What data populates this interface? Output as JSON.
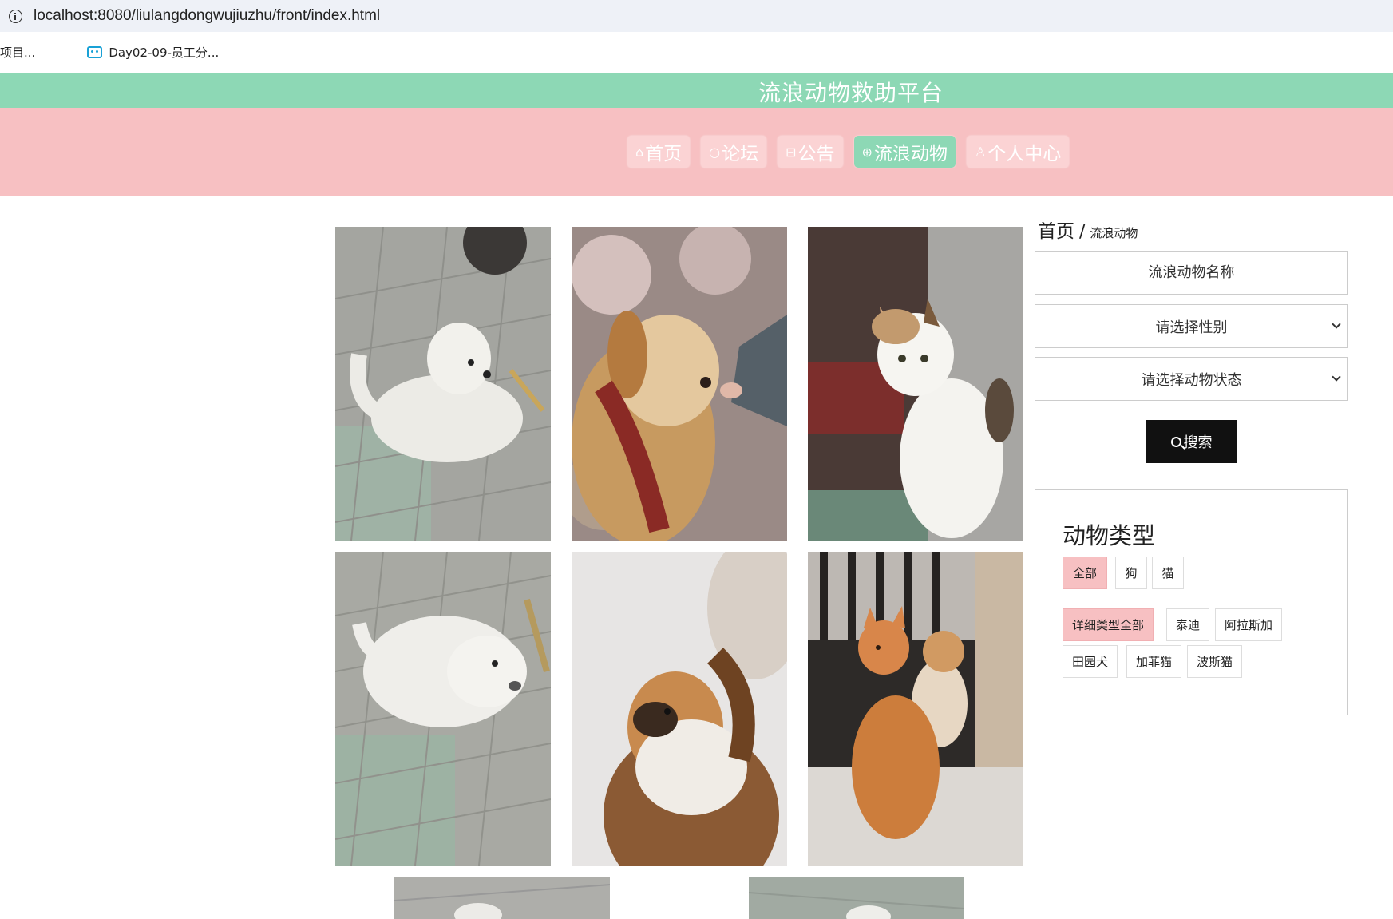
{
  "browser": {
    "url_host": "localhost",
    "url_rest": ":8080/liulangdongwujiuzhu/front/index.html",
    "bookmarks": [
      {
        "label": "项目..."
      },
      {
        "label": "Day02-09-员工分...",
        "icon": "tv-icon"
      }
    ]
  },
  "header": {
    "site_title": "流浪动物救助平台",
    "nav": [
      {
        "label": "首页",
        "icon": "⌂",
        "active": false
      },
      {
        "label": "论坛",
        "icon": "○",
        "active": false
      },
      {
        "label": "公告",
        "icon": "⊟",
        "active": false
      },
      {
        "label": "流浪动物",
        "icon": "⊕",
        "active": true
      },
      {
        "label": "个人中心",
        "icon": "♙",
        "active": false
      }
    ],
    "colors": {
      "title_bar": "#8dd8b5",
      "nav_bar": "#f7c0c2",
      "nav_active": "#8dd8b5"
    }
  },
  "breadcrumb": {
    "home": "首页",
    "separator": "/",
    "current": "流浪动物"
  },
  "search": {
    "name_placeholder": "流浪动物名称",
    "gender_select": "请选择性别",
    "status_select": "请选择动物状态",
    "button_label": "搜索"
  },
  "type_panel": {
    "title": "动物类型",
    "types": [
      {
        "label": "全部",
        "selected": true
      },
      {
        "label": "狗",
        "selected": false
      },
      {
        "label": "猫",
        "selected": false
      }
    ],
    "sub_types": [
      {
        "label": "详细类型全部",
        "selected": true
      },
      {
        "label": "泰迪",
        "selected": false
      },
      {
        "label": "阿拉斯加",
        "selected": false
      },
      {
        "label": "田园犬",
        "selected": false
      },
      {
        "label": "加菲猫",
        "selected": false
      },
      {
        "label": "波斯猫",
        "selected": false
      }
    ]
  },
  "gallery": [
    {
      "subject": "white-puppy-lying"
    },
    {
      "subject": "golden-dog-sniffing-hand"
    },
    {
      "subject": "white-calico-cat"
    },
    {
      "subject": "white-puppy-resting"
    },
    {
      "subject": "pekingese-dog"
    },
    {
      "subject": "orange-cats-pair"
    },
    {
      "subject": "partial-photo"
    },
    {
      "subject": "partial-photo"
    }
  ]
}
